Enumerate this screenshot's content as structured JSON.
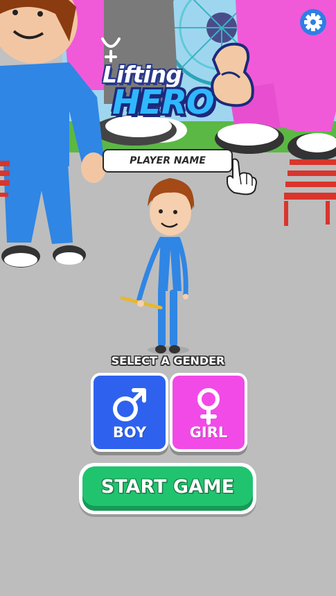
{
  "app": {
    "logo_line1": "Lifting",
    "logo_line2": "HERO"
  },
  "player_name": {
    "value": "",
    "placeholder": "PLAYER NAME"
  },
  "gender": {
    "title": "SELECT A GENDER",
    "options": [
      {
        "label": "BOY",
        "icon": "male-symbol-icon",
        "color": "#2e62ee"
      },
      {
        "label": "GIRL",
        "icon": "female-symbol-icon",
        "color": "#f24ae6"
      }
    ]
  },
  "start": {
    "label": "START GAME",
    "color": "#20c46f"
  },
  "icons": {
    "settings": "gear-icon",
    "tap_hint": "pointing-hand-icon",
    "flexed_arm": "flexed-biceps-icon"
  }
}
